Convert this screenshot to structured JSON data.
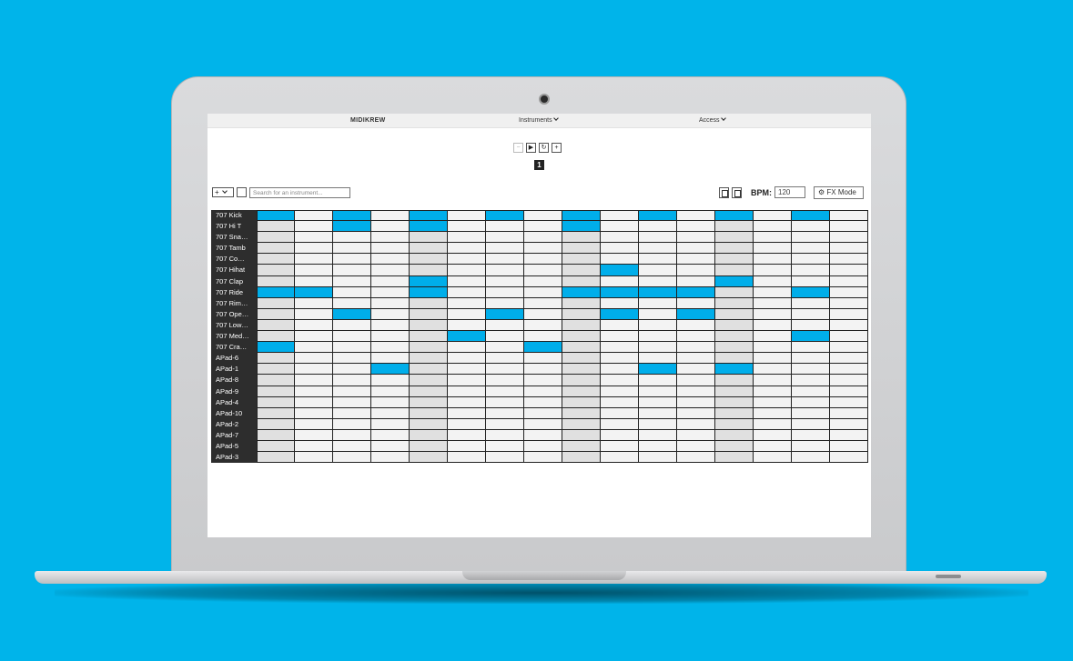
{
  "nav": {
    "brand": "MIDIKREW",
    "instruments": "Instruments",
    "access": "Access"
  },
  "transport": {
    "minus": "−",
    "play": "▶",
    "loop": "↻",
    "plus": "+",
    "pattern": "1"
  },
  "toolbar": {
    "add_symbol": "+",
    "trash_symbol": "🗑",
    "search_placeholder": "Search for an instrument...",
    "bpm_label": "BPM:",
    "bpm_value": "120",
    "fx_label": "FX Mode"
  },
  "sequencer": {
    "steps": 16,
    "active_color": "#00aeea",
    "tracks": [
      {
        "name": "707 Kick",
        "on": [
          0,
          2,
          4,
          6,
          8,
          10,
          12,
          14
        ]
      },
      {
        "name": "707 Hi T",
        "on": [
          2,
          4,
          8
        ]
      },
      {
        "name": "707 Sna…",
        "on": []
      },
      {
        "name": "707 Tamb",
        "on": []
      },
      {
        "name": "707 Co…",
        "on": []
      },
      {
        "name": "707 Hihat",
        "on": [
          9
        ]
      },
      {
        "name": "707 Clap",
        "on": [
          4,
          12
        ]
      },
      {
        "name": "707 Ride",
        "on": [
          0,
          1,
          4,
          8,
          9,
          10,
          11,
          14
        ]
      },
      {
        "name": "707 Rim…",
        "on": []
      },
      {
        "name": "707 Ope…",
        "on": [
          2,
          6,
          9,
          11
        ]
      },
      {
        "name": "707 Low…",
        "on": []
      },
      {
        "name": "707 Med…",
        "on": [
          5,
          14
        ]
      },
      {
        "name": "707 Cra…",
        "on": [
          0,
          7
        ]
      },
      {
        "name": "APad-6",
        "on": []
      },
      {
        "name": "APad-1",
        "on": [
          3,
          10,
          12
        ]
      },
      {
        "name": "APad-8",
        "on": []
      },
      {
        "name": "APad-9",
        "on": []
      },
      {
        "name": "APad-4",
        "on": []
      },
      {
        "name": "APad-10",
        "on": []
      },
      {
        "name": "APad-2",
        "on": []
      },
      {
        "name": "APad-7",
        "on": []
      },
      {
        "name": "APad-5",
        "on": []
      },
      {
        "name": "APad-3",
        "on": []
      }
    ]
  }
}
